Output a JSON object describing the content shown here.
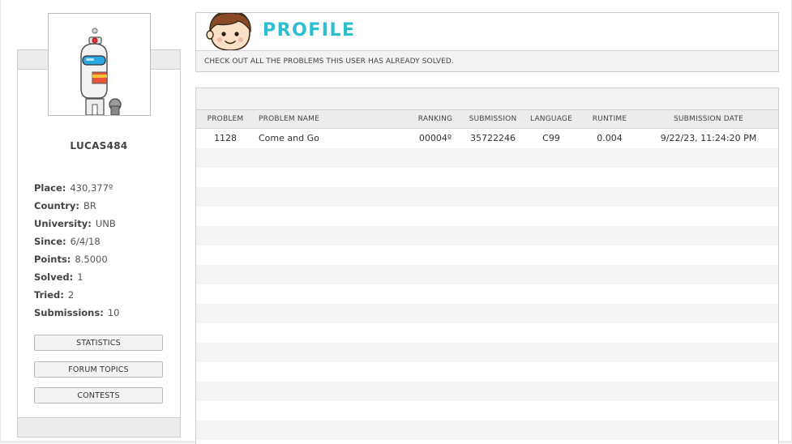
{
  "user": {
    "username": "LUCAS484",
    "info": [
      {
        "key": "Place:",
        "value": "430,377º"
      },
      {
        "key": "Country:",
        "value": "BR"
      },
      {
        "key": "University:",
        "value": "UNB"
      },
      {
        "key": "Since:",
        "value": "6/4/18"
      },
      {
        "key": "Points:",
        "value": "8.5000"
      },
      {
        "key": "Solved:",
        "value": "1"
      },
      {
        "key": "Tried:",
        "value": "2"
      },
      {
        "key": "Submissions:",
        "value": "10"
      }
    ]
  },
  "sidebar_buttons": {
    "statistics": "STATISTICS",
    "forum_topics": "FORUM TOPICS",
    "contests": "CONTESTS"
  },
  "profile": {
    "title": "PROFILE",
    "subtitle": "CHECK OUT ALL THE PROBLEMS THIS USER HAS ALREADY SOLVED."
  },
  "table": {
    "columns": {
      "problem": "PROBLEM",
      "name": "PROBLEM NAME",
      "ranking": "RANKING",
      "submission": "SUBMISSION",
      "language": "LANGUAGE",
      "runtime": "RUNTIME",
      "date": "SUBMISSION DATE"
    },
    "rows": [
      {
        "problem": "1128",
        "name": "Come and Go",
        "ranking": "00004º",
        "submission": "35722246",
        "language": "C99",
        "runtime": "0.004",
        "date": "9/22/23, 11:24:20 PM"
      }
    ]
  },
  "colors": {
    "accent": "#2bbfd0",
    "panel_bar": "#f2f2f2",
    "border": "#cfcfcf"
  },
  "icons": {
    "avatar": "robot-avatar-icon",
    "profile": "boy-face-icon"
  }
}
